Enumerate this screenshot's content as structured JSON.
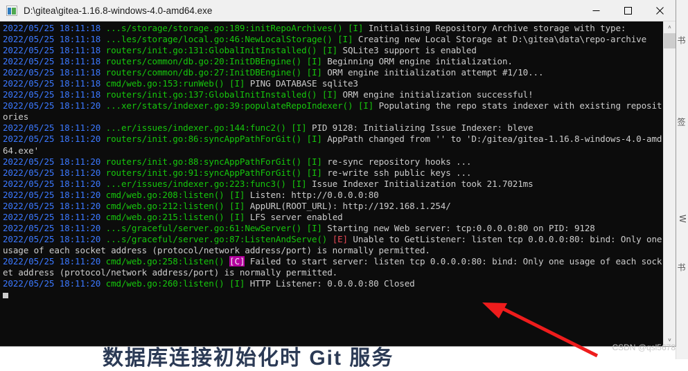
{
  "window": {
    "title": "D:\\gitea\\gitea-1.16.8-windows-4.0-amd64.exe",
    "icon": "console-app-icon",
    "minimize_label": "—",
    "maximize_label": "□",
    "close_label": "✕"
  },
  "scrollbar": {
    "up_arrow": "˄",
    "down_arrow": "˅"
  },
  "annotation": {
    "arrow_color": "#ee1c1c",
    "watermark": "CSDN @qsl5678"
  },
  "backdrop": {
    "heading": "数据库连接初始化时 Git 服务",
    "side_glyphs": [
      "书",
      "签",
      "W",
      "书"
    ]
  },
  "console": {
    "prompt_cursor": true,
    "lines": [
      {
        "ts": "2022/05/25 18:11:18",
        "src": "...s/storage/storage.go:189:initRepoArchives()",
        "lvl": "[I]",
        "lvlkind": "I",
        "msg": "Initialising Repository Archive storage with type:"
      },
      {
        "ts": "2022/05/25 18:11:18",
        "src": "...les/storage/local.go:46:NewLocalStorage()",
        "lvl": "[I]",
        "lvlkind": "I",
        "msg": "Creating new Local Storage at D:\\gitea\\data\\repo-archive"
      },
      {
        "ts": "2022/05/25 18:11:18",
        "src": "routers/init.go:131:GlobalInitInstalled()",
        "lvl": "[I]",
        "lvlkind": "I",
        "msg": "SQLite3 support is enabled"
      },
      {
        "ts": "2022/05/25 18:11:18",
        "src": "routers/common/db.go:20:InitDBEngine()",
        "lvl": "[I]",
        "lvlkind": "I",
        "msg": "Beginning ORM engine initialization."
      },
      {
        "ts": "2022/05/25 18:11:18",
        "src": "routers/common/db.go:27:InitDBEngine()",
        "lvl": "[I]",
        "lvlkind": "I",
        "msg": "ORM engine initialization attempt #1/10..."
      },
      {
        "ts": "2022/05/25 18:11:18",
        "src": "cmd/web.go:153:runWeb()",
        "lvl": "[I]",
        "lvlkind": "I",
        "msg": "PING DATABASE sqlite3"
      },
      {
        "ts": "2022/05/25 18:11:18",
        "src": "routers/init.go:137:GlobalInitInstalled()",
        "lvl": "[I]",
        "lvlkind": "I",
        "msg": "ORM engine initialization successful!"
      },
      {
        "ts": "2022/05/25 18:11:20",
        "src": "...xer/stats/indexer.go:39:populateRepoIndexer()",
        "lvl": "[I]",
        "lvlkind": "I",
        "msg": "Populating the repo stats indexer with existing repositories"
      },
      {
        "ts": "2022/05/25 18:11:20",
        "src": "...er/issues/indexer.go:144:func2()",
        "lvl": "[I]",
        "lvlkind": "I",
        "msg": "PID 9128: Initializing Issue Indexer: bleve"
      },
      {
        "ts": "2022/05/25 18:11:20",
        "src": "routers/init.go:86:syncAppPathForGit()",
        "lvl": "[I]",
        "lvlkind": "I",
        "msg": "AppPath changed from '' to 'D:/gitea/gitea-1.16.8-windows-4.0-amd64.exe'"
      },
      {
        "ts": "2022/05/25 18:11:20",
        "src": "routers/init.go:88:syncAppPathForGit()",
        "lvl": "[I]",
        "lvlkind": "I",
        "msg": "re-sync repository hooks ..."
      },
      {
        "ts": "2022/05/25 18:11:20",
        "src": "routers/init.go:91:syncAppPathForGit()",
        "lvl": "[I]",
        "lvlkind": "I",
        "msg": "re-write ssh public keys ..."
      },
      {
        "ts": "2022/05/25 18:11:20",
        "src": "...er/issues/indexer.go:223:func3()",
        "lvl": "[I]",
        "lvlkind": "I",
        "msg": "Issue Indexer Initialization took 21.7021ms"
      },
      {
        "ts": "2022/05/25 18:11:20",
        "src": "cmd/web.go:208:listen()",
        "lvl": "[I]",
        "lvlkind": "I",
        "msg": "Listen: http://0.0.0.0:80"
      },
      {
        "ts": "2022/05/25 18:11:20",
        "src": "cmd/web.go:212:listen()",
        "lvl": "[I]",
        "lvlkind": "I",
        "msg": "AppURL(ROOT_URL): http://192.168.1.254/"
      },
      {
        "ts": "2022/05/25 18:11:20",
        "src": "cmd/web.go:215:listen()",
        "lvl": "[I]",
        "lvlkind": "I",
        "msg": "LFS server enabled"
      },
      {
        "ts": "2022/05/25 18:11:20",
        "src": "...s/graceful/server.go:61:NewServer()",
        "lvl": "[I]",
        "lvlkind": "I",
        "msg": "Starting new Web server: tcp:0.0.0.0:80 on PID: 9128"
      },
      {
        "ts": "2022/05/25 18:11:20",
        "src": "...s/graceful/server.go:87:ListenAndServe()",
        "lvl": "[E]",
        "lvlkind": "E",
        "msg": "Unable to GetListener: listen tcp 0.0.0.0:80: bind: Only one usage of each socket address (protocol/network address/port) is normally permitted."
      },
      {
        "ts": "2022/05/25 18:11:20",
        "src": "cmd/web.go:258:listen()",
        "lvl": "[C]",
        "lvlkind": "C",
        "msg": "Failed to start server: listen tcp 0.0.0.0:80: bind: Only one usage of each socket address (protocol/network address/port) is normally permitted."
      },
      {
        "ts": "2022/05/25 18:11:20",
        "src": "cmd/web.go:260:listen()",
        "lvl": "[I]",
        "lvlkind": "I",
        "msg": "HTTP Listener: 0.0.0.0:80 Closed"
      }
    ]
  }
}
